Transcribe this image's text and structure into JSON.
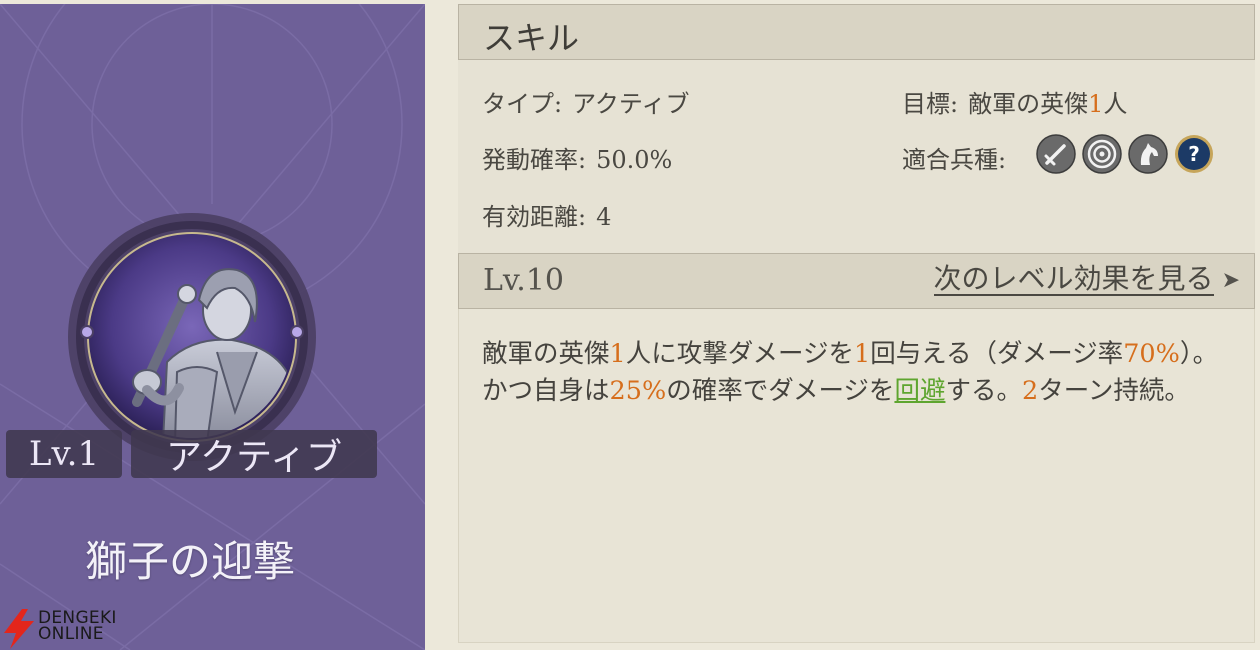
{
  "card": {
    "level": "Lv.1",
    "type": "アクティブ",
    "name": "獅子の迎撃"
  },
  "watermark": {
    "line1": "DENGEKI",
    "line2": "ONLINE"
  },
  "skill_section": {
    "title": "スキル",
    "type_label": "タイプ:",
    "type_value": "アクティブ",
    "chance_label": "発動確率:",
    "chance_value": "50.0%",
    "range_label": "有効距離:",
    "range_value": "4",
    "target_label": "目標:",
    "target_pre": "敵軍の英傑",
    "target_num": "1",
    "target_post": "人",
    "units_label": "適合兵種:",
    "unit_icons": [
      "sword-icon",
      "target-icon",
      "horse-icon",
      "question-icon"
    ]
  },
  "level_section": {
    "title": "Lv.10",
    "next_label": "次のレベル効果を見る",
    "arrow": "➤"
  },
  "description": {
    "p1": "敵軍の英傑",
    "n1": "1",
    "p2": "人に攻撃ダメージを",
    "n2": "1",
    "p3": "回与える（ダメージ率",
    "n3": "70%",
    "p4": "）。かつ自身は",
    "n4": "25%",
    "p5": "の確率でダメージを",
    "g1": "回避",
    "p6": "する。",
    "n5": "2",
    "p7": "ターン持続。"
  },
  "colors": {
    "highlight": "#d66e1c",
    "keyword": "#5ea52f",
    "card_bg": "#6e6098"
  }
}
